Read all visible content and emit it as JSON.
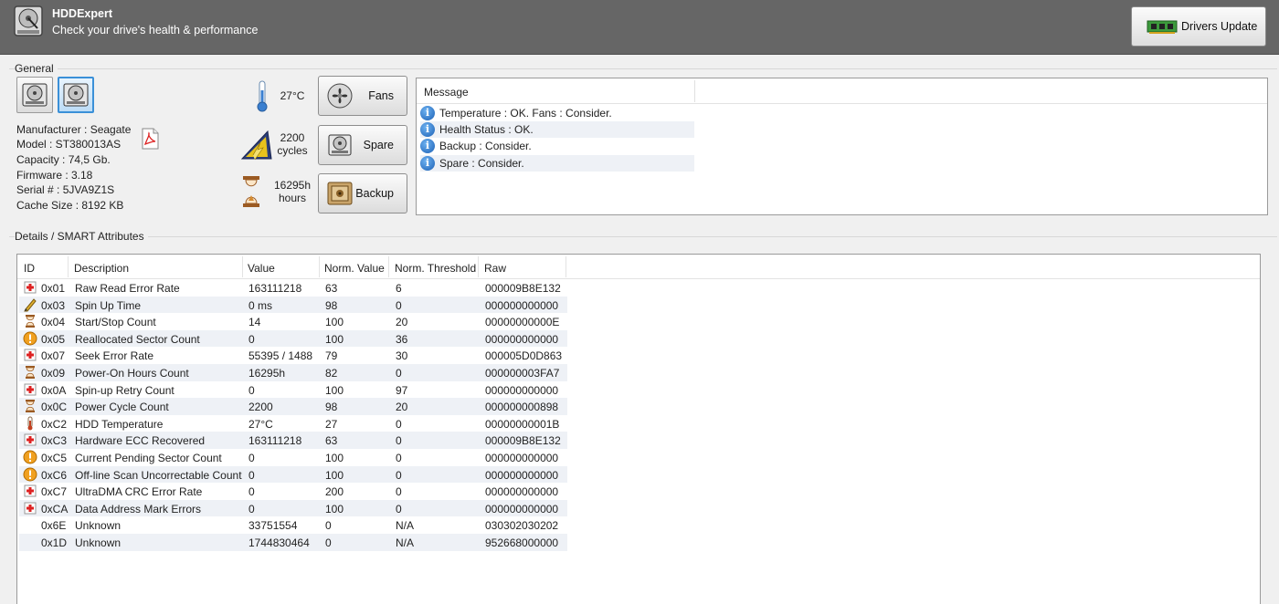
{
  "header": {
    "title": "HDDExpert",
    "subtitle": "Check your drive's health & performance",
    "drivers_update_label": "Drivers Update"
  },
  "general": {
    "group_label": "General",
    "drive_info": {
      "manufacturer": "Manufacturer : Seagate",
      "model": "Model : ST380013AS",
      "capacity": "Capacity : 74,5 Gb.",
      "firmware": "Firmware : 3.18",
      "serial": "Serial # : 5JVA9Z1S",
      "cache": "Cache Size : 8192 KB"
    },
    "stats": {
      "temperature": "27°C",
      "cycles_value": "2200",
      "cycles_unit": "cycles",
      "hours_value": "16295h",
      "hours_unit": "hours"
    },
    "buttons": {
      "fans": "Fans",
      "spare": "Spare",
      "backup": "Backup"
    },
    "messages": {
      "header": "Message",
      "items": [
        "Temperature : OK. Fans : Consider.",
        "Health Status : OK.",
        "Backup : Consider.",
        "Spare : Consider."
      ]
    }
  },
  "smart": {
    "group_label": "Details / SMART Attributes",
    "columns": [
      "ID",
      "Description",
      "Value",
      "Norm. Value",
      "Norm. Threshold",
      "Raw"
    ],
    "rows": [
      {
        "icon": "red-cross-icon",
        "id": "0x01",
        "desc": "Raw Read Error Rate",
        "value": "163111218",
        "norm": "63",
        "thresh": "6",
        "raw": "000009B8E132"
      },
      {
        "icon": "pencil-icon",
        "id": "0x03",
        "desc": "Spin Up Time",
        "value": "0 ms",
        "norm": "98",
        "thresh": "0",
        "raw": "000000000000"
      },
      {
        "icon": "hourglass-icon",
        "id": "0x04",
        "desc": "Start/Stop Count",
        "value": "14",
        "norm": "100",
        "thresh": "20",
        "raw": "00000000000E"
      },
      {
        "icon": "warning-icon",
        "id": "0x05",
        "desc": "Reallocated Sector Count",
        "value": "0",
        "norm": "100",
        "thresh": "36",
        "raw": "000000000000"
      },
      {
        "icon": "red-cross-icon",
        "id": "0x07",
        "desc": "Seek Error Rate",
        "value": "55395 / 1488",
        "norm": "79",
        "thresh": "30",
        "raw": "000005D0D863"
      },
      {
        "icon": "hourglass-icon",
        "id": "0x09",
        "desc": "Power-On Hours Count",
        "value": "16295h",
        "norm": "82",
        "thresh": "0",
        "raw": "000000003FA7"
      },
      {
        "icon": "red-cross-icon",
        "id": "0x0A",
        "desc": "Spin-up Retry Count",
        "value": "0",
        "norm": "100",
        "thresh": "97",
        "raw": "000000000000"
      },
      {
        "icon": "hourglass-icon",
        "id": "0x0C",
        "desc": "Power Cycle Count",
        "value": "2200",
        "norm": "98",
        "thresh": "20",
        "raw": "000000000898"
      },
      {
        "icon": "thermometer-icon",
        "id": "0xC2",
        "desc": "HDD Temperature",
        "value": "27°C",
        "norm": "27",
        "thresh": "0",
        "raw": "00000000001B"
      },
      {
        "icon": "red-cross-icon",
        "id": "0xC3",
        "desc": "Hardware ECC Recovered",
        "value": "163111218",
        "norm": "63",
        "thresh": "0",
        "raw": "000009B8E132"
      },
      {
        "icon": "warning-icon",
        "id": "0xC5",
        "desc": "Current Pending Sector Count",
        "value": "0",
        "norm": "100",
        "thresh": "0",
        "raw": "000000000000"
      },
      {
        "icon": "warning-icon",
        "id": "0xC6",
        "desc": "Off-line Scan Uncorrectable Count",
        "value": "0",
        "norm": "100",
        "thresh": "0",
        "raw": "000000000000"
      },
      {
        "icon": "red-cross-icon",
        "id": "0xC7",
        "desc": "UltraDMA CRC Error Rate",
        "value": "0",
        "norm": "200",
        "thresh": "0",
        "raw": "000000000000"
      },
      {
        "icon": "red-cross-icon",
        "id": "0xCA",
        "desc": "Data Address Mark Errors",
        "value": "0",
        "norm": "100",
        "thresh": "0",
        "raw": "000000000000"
      },
      {
        "icon": "",
        "id": "0x6E",
        "desc": "Unknown",
        "value": "33751554",
        "norm": "0",
        "thresh": "N/A",
        "raw": "030302030202"
      },
      {
        "icon": "",
        "id": "0x1D",
        "desc": "Unknown",
        "value": "1744830464",
        "norm": "0",
        "thresh": "N/A",
        "raw": "952668000000"
      }
    ]
  }
}
